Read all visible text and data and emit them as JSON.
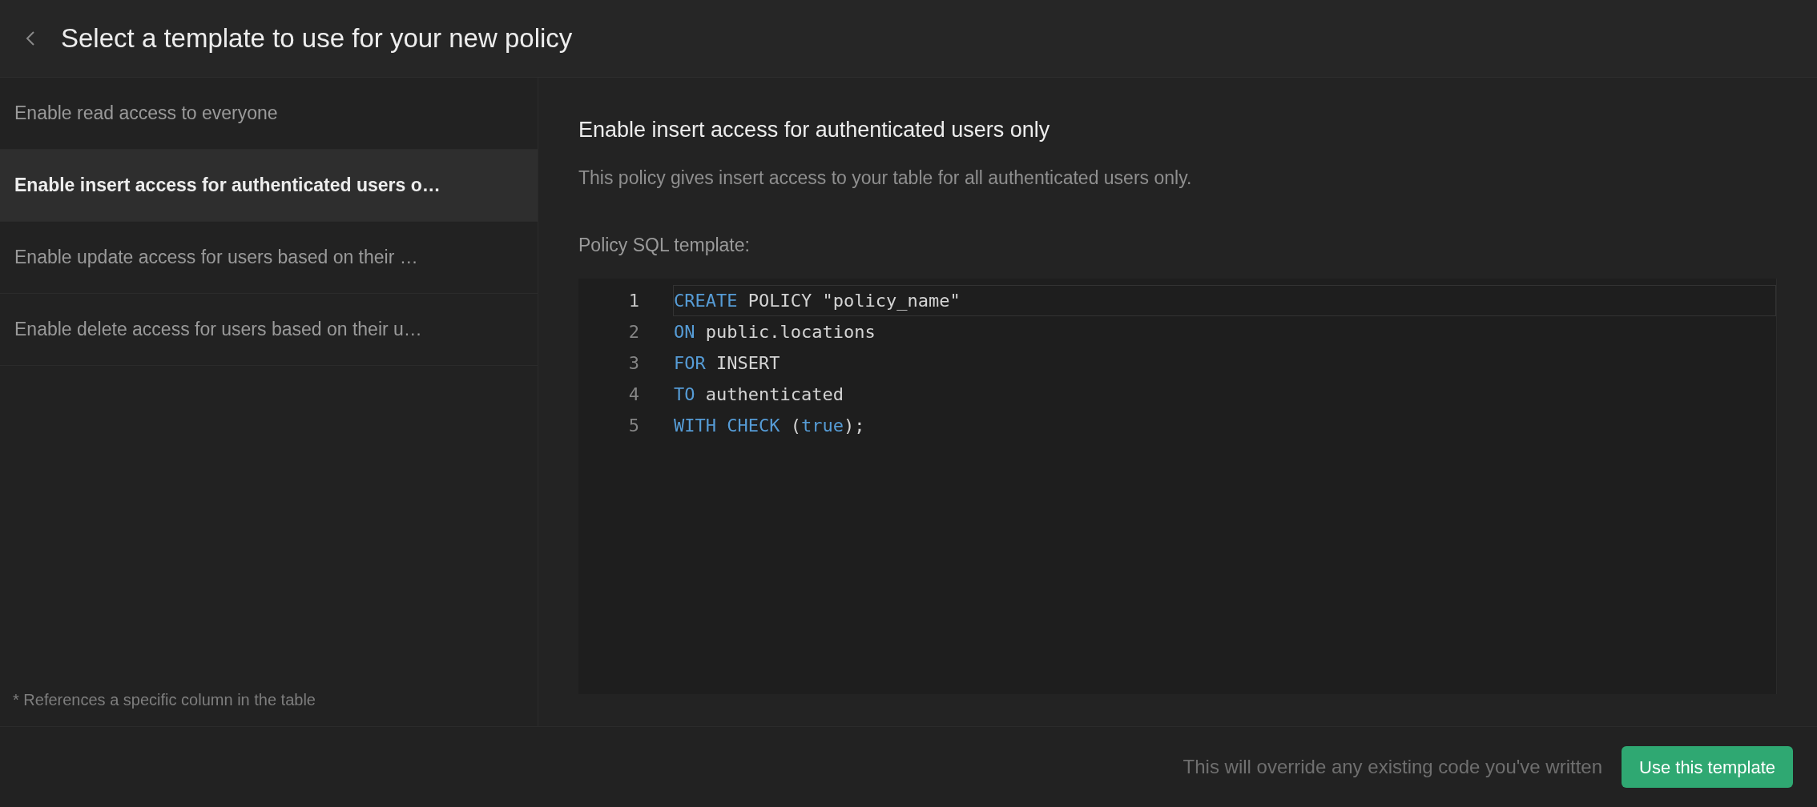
{
  "header": {
    "title": "Select a template to use for your new policy"
  },
  "templates": [
    {
      "label": "Enable read access to everyone",
      "selected": false
    },
    {
      "label": "Enable insert access for authenticated users o…",
      "selected": true
    },
    {
      "label": "Enable update access for users based on their …",
      "selected": false
    },
    {
      "label": "Enable delete access for users based on their u…",
      "selected": false
    }
  ],
  "footnote": "* References a specific column in the table",
  "detail": {
    "title": "Enable insert access for authenticated users only",
    "description": "This policy gives insert access to your table for all authenticated users only.",
    "code_label": "Policy SQL template:"
  },
  "code": {
    "lines": [
      {
        "number": "1",
        "active": true,
        "tokens": [
          {
            "text": "CREATE",
            "kind": "keyword"
          },
          {
            "text": " POLICY \"policy_name\"",
            "kind": "plain"
          }
        ]
      },
      {
        "number": "2",
        "active": false,
        "tokens": [
          {
            "text": "ON",
            "kind": "keyword"
          },
          {
            "text": " public.locations",
            "kind": "plain"
          }
        ]
      },
      {
        "number": "3",
        "active": false,
        "tokens": [
          {
            "text": "FOR",
            "kind": "keyword"
          },
          {
            "text": " INSERT",
            "kind": "plain"
          }
        ]
      },
      {
        "number": "4",
        "active": false,
        "tokens": [
          {
            "text": "TO",
            "kind": "keyword"
          },
          {
            "text": " authenticated",
            "kind": "plain"
          }
        ]
      },
      {
        "number": "5",
        "active": false,
        "tokens": [
          {
            "text": "WITH CHECK",
            "kind": "keyword"
          },
          {
            "text": " (",
            "kind": "plain"
          },
          {
            "text": "true",
            "kind": "keyword"
          },
          {
            "text": ");",
            "kind": "plain"
          }
        ]
      }
    ]
  },
  "footer": {
    "warning": "This will override any existing code you've written",
    "button": "Use this template"
  }
}
